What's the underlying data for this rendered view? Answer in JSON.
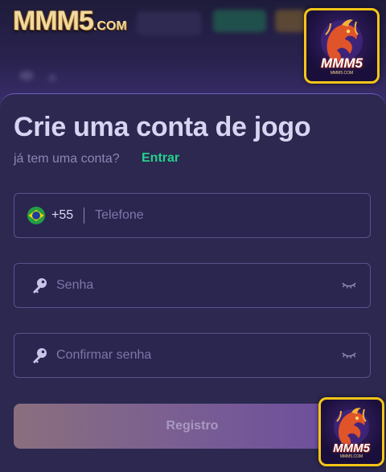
{
  "header": {
    "brand": "MMM5",
    "brand_suffix": ".COM"
  },
  "app_icon": {
    "text": "MMM5",
    "sub": "MMM5.COM"
  },
  "form": {
    "title": "Crie uma conta de jogo",
    "have_account": "já tem uma conta?",
    "login_link": "Entrar",
    "phone": {
      "country_flag": "brazil-flag-icon",
      "dial_code": "+55",
      "placeholder": "Telefone",
      "value": ""
    },
    "password": {
      "placeholder": "Senha",
      "value": ""
    },
    "confirm_password": {
      "placeholder": "Confirmar senha",
      "value": ""
    },
    "submit_label": "Registro"
  },
  "colors": {
    "accent_link": "#23d18b",
    "sheet_bg": "#2c2850",
    "field_border": "#5a538e",
    "icon_border": "#f5c518"
  }
}
